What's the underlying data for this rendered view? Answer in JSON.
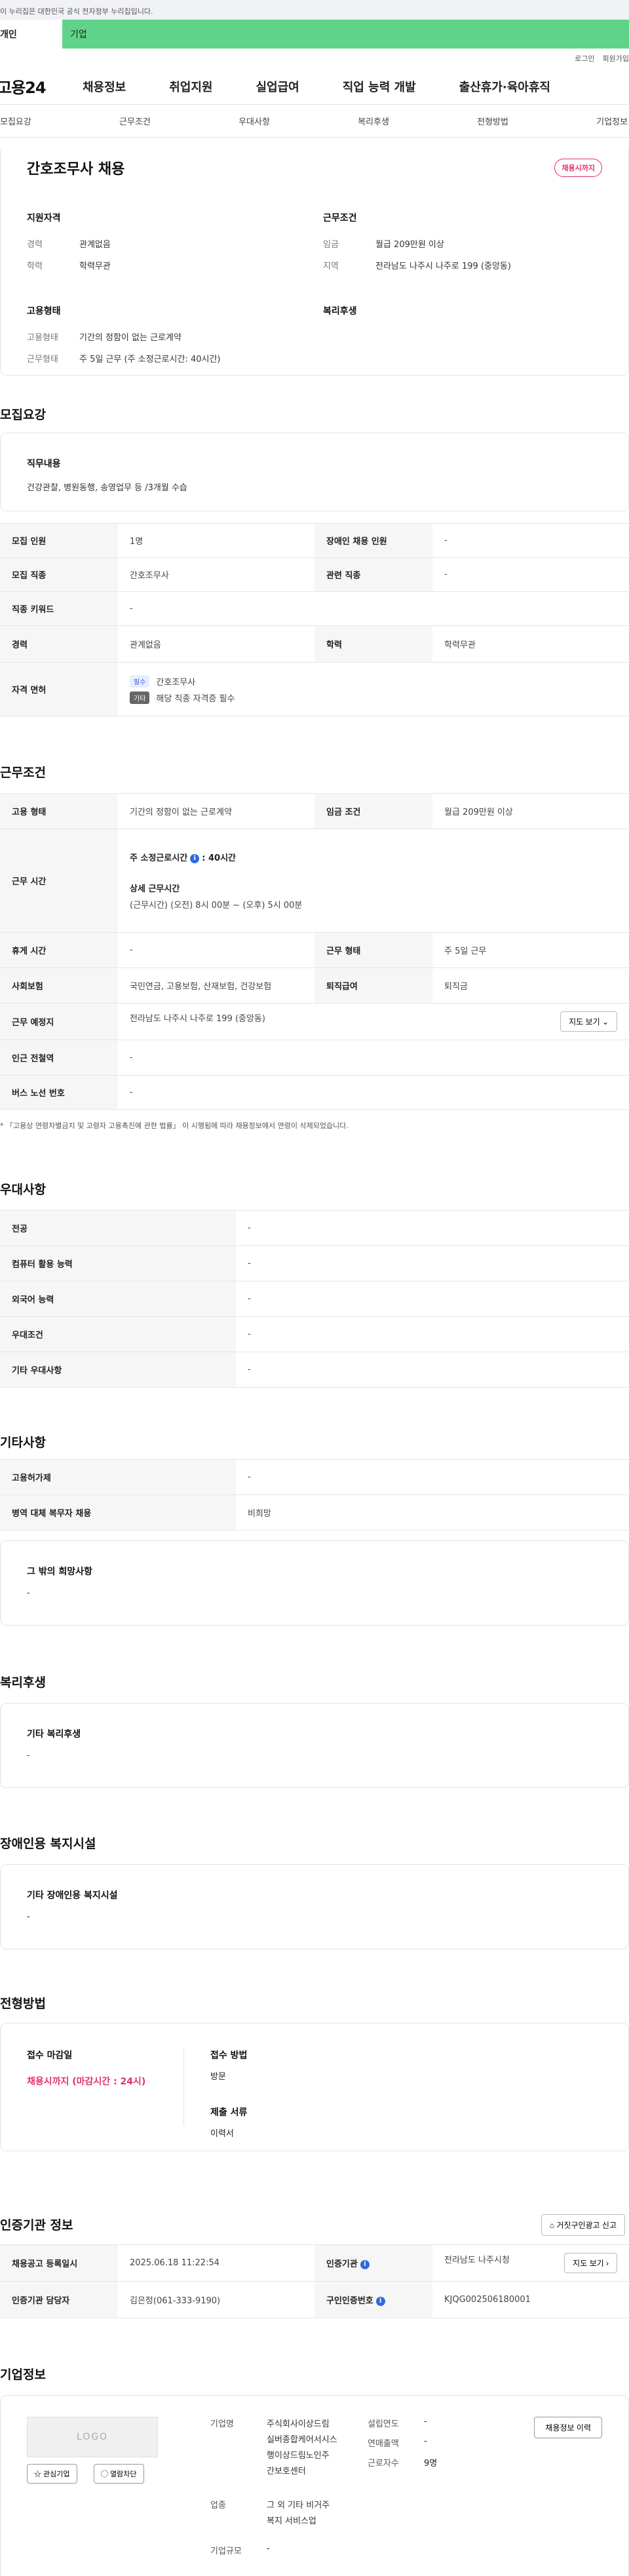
{
  "banner": {
    "text": "이 누리집은 대한민국 공식 전자정부 누리집입니다."
  },
  "user_tabs": [
    "개인",
    "기업"
  ],
  "util": {
    "login": "로그인",
    "join": "회원가입"
  },
  "gnb": {
    "logo": "고용24",
    "items": [
      "채용정보",
      "취업지원",
      "실업급여",
      "직업 능력 개발",
      "출산휴가·육아휴직"
    ]
  },
  "subtabs": [
    "모집요강",
    "근무조건",
    "우대사항",
    "복리후생",
    "전형방법",
    "기업정보"
  ],
  "summary": {
    "title": "간호조무사 채용",
    "deadline_badge": "채용시까지",
    "qualification": {
      "head": "지원자격",
      "career_k": "경력",
      "career_v": "관계없음",
      "edu_k": "학력",
      "edu_v": "학력무관"
    },
    "conditions": {
      "head": "근무조건",
      "wage_k": "임금",
      "wage_v": "월급 209만원 이상",
      "region_k": "지역",
      "region_v": "전라남도 나주시 나주로 199 (중앙동)"
    },
    "employment": {
      "head": "고용형태",
      "type_k": "고용형태",
      "type_v": "기간의 정함이 없는 근로계약",
      "work_k": "근무형태",
      "work_v": "주 5일 근무 (주 소정근로시간: 40시간)"
    },
    "welfare": {
      "head": "복리후생"
    }
  },
  "recruit": {
    "title": "모집요강",
    "duty_head": "직무내용",
    "duty_text": "건강관찰, 병원동행, 송영업무 등 /3개월 수습",
    "rows": {
      "count_k": "모집 인원",
      "count_v": "1명",
      "disabled_k": "장애인 채용 인원",
      "disabled_v": "-",
      "job_k": "모집 직종",
      "job_v": "간호조무사",
      "related_k": "관련 직종",
      "related_v": "-",
      "keyword_k": "직종 키워드",
      "keyword_v": "-",
      "career_k": "경력",
      "career_v": "관계없음",
      "edu_k": "학력",
      "edu_v": "학력무관",
      "license_k": "자격 면허",
      "license_tag1": "필수",
      "license_name": "간호조무사",
      "license_tag2": "기타",
      "license_note": "해당 직종 자격증 필수"
    }
  },
  "work": {
    "title": "근무조건",
    "type_k": "고용 형태",
    "type_v": "기간의 정함이 없는 근로계약",
    "wage_k": "임금 조건",
    "wage_v": "월급 209만원 이상",
    "hours_k": "근무 시간",
    "hours_week": "주 소정근로시간",
    "hours_week_v": ": 40시간",
    "hours_detail_head": "상세 근무시간",
    "hours_detail": "(근무시간) (오전) 8시 00분 ~ (오후) 5시 00분",
    "rest_k": "휴게 시간",
    "rest_v": "-",
    "form_k": "근무 형태",
    "form_v": "주 5일 근무",
    "insurance_k": "사회보험",
    "insurance_v": "국민연금, 고용보험, 산재보험, 건강보험",
    "retire_k": "퇴직급여",
    "retire_v": "퇴직금",
    "place_k": "근무 예정지",
    "place_v": "전라남도 나주시 나주로 199 (중앙동)",
    "map_btn": "지도 보기 ⌄",
    "subway_k": "인근 전철역",
    "subway_v": "-",
    "bus_k": "버스 노선 번호",
    "bus_v": "-",
    "note": "* 「고용상 연령차별금지 및 고령자 고용촉진에 관한 법률」 이 시행됨에 따라 채용정보에서 연령이 삭제되었습니다."
  },
  "pref": {
    "title": "우대사항",
    "rows": [
      {
        "k": "전공",
        "v": "-"
      },
      {
        "k": "컴퓨터 활용 능력",
        "v": "-"
      },
      {
        "k": "외국어 능력",
        "v": "-"
      },
      {
        "k": "우대조건",
        "v": "-"
      },
      {
        "k": "기타 우대사항",
        "v": "-"
      }
    ]
  },
  "etc": {
    "title": "기타사항",
    "rows": [
      {
        "k": "고용허가제",
        "v": "-"
      },
      {
        "k": "병역 대체 복무자 채용",
        "v": "비희망"
      }
    ],
    "other_head": "그 밖의 희망사항",
    "other_v": "-"
  },
  "welfare": {
    "title": "복리후생",
    "head": "기타 복리후생",
    "v": "-"
  },
  "disabled_fac": {
    "title": "장애인용 복지시설",
    "head": "기타 장애인용 복지시설",
    "v": "-"
  },
  "process": {
    "title": "전형방법",
    "deadline_head": "접수 마감일",
    "deadline_v": "채용시까지 (마감시간 : 24시)",
    "method_head": "접수 방법",
    "method_v": "방문",
    "docs_head": "제출 서류",
    "docs_v": "이력서"
  },
  "cert": {
    "title": "인증기관 정보",
    "report_btn": "⌂ 거짓구인광고 신고",
    "reg_k": "채용공고 등록일시",
    "reg_v": "2025.06.18 11:22:54",
    "agency_k": "인증기관",
    "agency_v": "전라남도 나주시청",
    "map_btn": "지도 보기 ›",
    "manager_k": "인증기관 담당자",
    "manager_v": "김은정(061-333-9190)",
    "number_k": "구인인증번호",
    "number_v": "KJQG002506180001"
  },
  "company": {
    "title": "기업정보",
    "logo_text": "LOGO",
    "fav_btn": "☆ 관심기업",
    "block_btn": "◯ 열람차단",
    "history_btn": "채용정보 이력",
    "name_k": "기업명",
    "name_v": "주식회사이상드림 실버종합케어서시스 행이상드림노인주 간보호센터",
    "year_k": "설립연도",
    "year_v": "-",
    "sales_k": "연매출액",
    "sales_v": "-",
    "staff_k": "근로자수",
    "staff_v": "9명",
    "industry_k": "업종",
    "industry_v": "그 외 기타 비거주 복지 서비스업",
    "size_k": "기업규모",
    "size_v": "-"
  }
}
